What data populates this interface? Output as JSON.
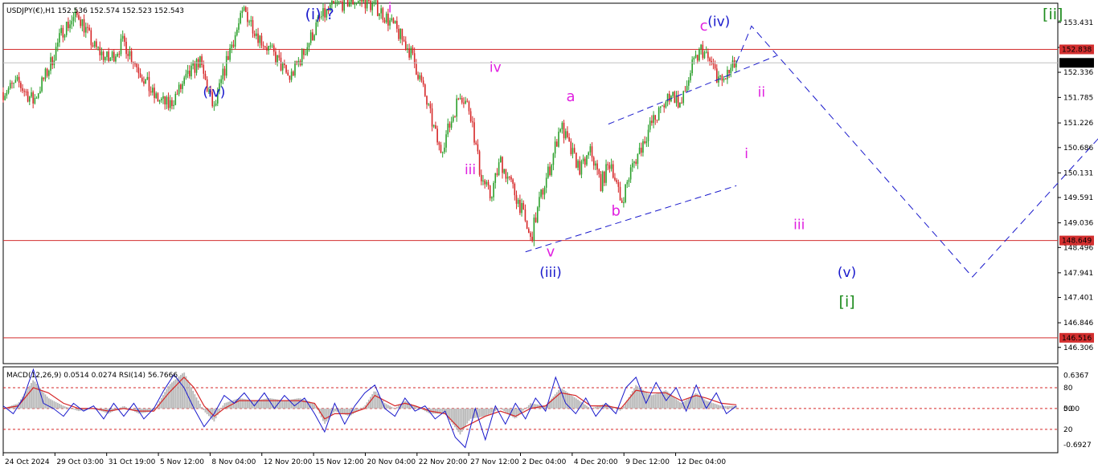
{
  "chart_data": {
    "type": "line",
    "title": "USDJPY(€),H1  152.536 152.574 152.523 152.543",
    "price_panel": {
      "ylim": [
        145.95,
        153.85
      ],
      "current_price": "152.543",
      "tick_labels": [
        "153.431",
        "152.881",
        "152.336",
        "151.785",
        "151.226",
        "150.686",
        "150.131",
        "149.591",
        "149.036",
        "148.496",
        "147.941",
        "147.401",
        "146.846",
        "146.306"
      ],
      "tick_values": [
        153.431,
        152.881,
        152.336,
        151.785,
        151.226,
        150.686,
        150.131,
        149.591,
        149.036,
        148.496,
        147.941,
        147.401,
        146.846,
        146.306
      ],
      "levels": [
        {
          "label": "152.838",
          "value": 152.838,
          "color": "#d32f2f"
        },
        {
          "label": "148.649",
          "value": 148.649,
          "color": "#d32f2f"
        },
        {
          "label": "146.516",
          "value": 146.516,
          "color": "#d32f2f"
        }
      ],
      "price_path": [
        [
          0,
          151.9
        ],
        [
          3,
          152.1
        ],
        [
          6,
          151.7
        ],
        [
          9,
          152.4
        ],
        [
          12,
          153.3
        ],
        [
          15,
          153.6
        ],
        [
          18,
          152.9
        ],
        [
          21,
          152.6
        ],
        [
          24,
          153.0
        ],
        [
          27,
          152.4
        ],
        [
          30,
          151.8
        ],
        [
          33,
          151.6
        ],
        [
          36,
          152.1
        ],
        [
          39,
          152.6
        ],
        [
          42,
          151.5
        ],
        [
          45,
          152.8
        ],
        [
          48,
          153.7
        ],
        [
          51,
          153.1
        ],
        [
          54,
          152.7
        ],
        [
          57,
          152.2
        ],
        [
          60,
          152.8
        ],
        [
          63,
          153.5
        ],
        [
          66,
          153.8
        ],
        [
          69,
          153.9
        ],
        [
          72,
          153.9
        ],
        [
          75,
          153.7
        ],
        [
          78,
          153.3
        ],
        [
          81,
          152.8
        ],
        [
          83,
          152.2
        ],
        [
          85,
          151.4
        ],
        [
          87,
          150.6
        ],
        [
          89,
          151.2
        ],
        [
          91,
          151.9
        ],
        [
          93,
          151.5
        ],
        [
          95,
          150.1
        ],
        [
          97,
          149.6
        ],
        [
          99,
          150.4
        ],
        [
          101,
          149.9
        ],
        [
          103,
          149.4
        ],
        [
          105,
          148.65
        ],
        [
          107,
          149.6
        ],
        [
          109,
          150.3
        ],
        [
          111,
          151.2
        ],
        [
          113,
          150.6
        ],
        [
          115,
          150.2
        ],
        [
          117,
          150.6
        ],
        [
          119,
          149.9
        ],
        [
          121,
          150.4
        ],
        [
          123,
          149.45
        ],
        [
          125,
          150.2
        ],
        [
          127,
          150.7
        ],
        [
          129,
          151.2
        ],
        [
          131,
          151.5
        ],
        [
          133,
          151.9
        ],
        [
          135,
          151.6
        ],
        [
          137,
          152.4
        ],
        [
          139,
          152.85
        ],
        [
          141,
          152.5
        ],
        [
          143,
          152.1
        ],
        [
          145,
          152.4
        ],
        [
          146,
          152.543
        ]
      ],
      "projection": [
        [
          146,
          152.543
        ],
        [
          149,
          153.35
        ],
        [
          193,
          147.85
        ],
        [
          243,
          153.9
        ]
      ],
      "channel_upper": [
        [
          120.5,
          151.2
        ],
        [
          154,
          152.7
        ]
      ],
      "channel_lower": [
        [
          104,
          148.4
        ],
        [
          146,
          149.85
        ]
      ],
      "wave_labels": [
        {
          "text": "(i) ?",
          "x": 63,
          "y": 153.5,
          "color": "#1a1acc",
          "size": 19
        },
        {
          "text": "i",
          "x": 77,
          "y": 153.65,
          "color": "#e020e0",
          "size": 17
        },
        {
          "text": "(iv)",
          "x": 42,
          "y": 151.8,
          "color": "#1a1acc",
          "size": 17
        },
        {
          "text": "iv",
          "x": 98,
          "y": 152.35,
          "color": "#e020e0",
          "size": 17
        },
        {
          "text": "iii",
          "x": 93,
          "y": 150.1,
          "color": "#e020e0",
          "size": 17
        },
        {
          "text": "a",
          "x": 113,
          "y": 151.7,
          "color": "#e020e0",
          "size": 18
        },
        {
          "text": "b",
          "x": 122,
          "y": 149.2,
          "color": "#e020e0",
          "size": 18
        },
        {
          "text": "v",
          "x": 109,
          "y": 148.3,
          "color": "#e020e0",
          "size": 18
        },
        {
          "text": "(iii)",
          "x": 109,
          "y": 147.85,
          "color": "#1a1acc",
          "size": 17
        },
        {
          "text": "c",
          "x": 139.5,
          "y": 153.25,
          "color": "#e020e0",
          "size": 18
        },
        {
          "text": "(iv)",
          "x": 142.5,
          "y": 153.35,
          "color": "#1a1acc",
          "size": 17
        },
        {
          "text": "ii",
          "x": 151,
          "y": 151.8,
          "color": "#e020e0",
          "size": 17
        },
        {
          "text": "i",
          "x": 148,
          "y": 150.45,
          "color": "#e020e0",
          "size": 17
        },
        {
          "text": "iii",
          "x": 158.5,
          "y": 148.9,
          "color": "#e020e0",
          "size": 17
        },
        {
          "text": "(v)",
          "x": 168,
          "y": 147.85,
          "color": "#1a1acc",
          "size": 17
        },
        {
          "text": "[i]",
          "x": 168,
          "y": 147.2,
          "color": "#1e8c1e",
          "size": 19
        },
        {
          "text": "[ii]",
          "x": 209,
          "y": 153.5,
          "color": "#1e8c1e",
          "size": 19
        }
      ]
    },
    "indicator_panel": {
      "label": "MACD(12,26,9) 0.0514 0.0274  RSI(14) 56.7666",
      "ylim": [
        -0.85,
        0.8
      ],
      "tick_labels": [
        "0.6367",
        "80",
        "50",
        "0.00",
        "20",
        "-0.6927"
      ],
      "tick_values": [
        0.6367,
        0.4,
        0.0,
        0.0,
        -0.4,
        -0.6927
      ],
      "levels": [
        0.4,
        0.0,
        -0.4
      ],
      "macd_path": [
        [
          0,
          0.0
        ],
        [
          3,
          0.1
        ],
        [
          6,
          0.55
        ],
        [
          9,
          0.2
        ],
        [
          12,
          0.05
        ],
        [
          15,
          -0.05
        ],
        [
          18,
          0.0
        ],
        [
          21,
          -0.1
        ],
        [
          24,
          0.05
        ],
        [
          27,
          -0.1
        ],
        [
          30,
          -0.05
        ],
        [
          33,
          0.45
        ],
        [
          36,
          0.7
        ],
        [
          38,
          0.3
        ],
        [
          40,
          -0.05
        ],
        [
          42,
          -0.25
        ],
        [
          44,
          0.1
        ],
        [
          47,
          0.2
        ],
        [
          50,
          0.15
        ],
        [
          53,
          0.2
        ],
        [
          56,
          0.15
        ],
        [
          59,
          0.2
        ],
        [
          62,
          0.1
        ],
        [
          64,
          -0.3
        ],
        [
          66,
          -0.05
        ],
        [
          69,
          -0.15
        ],
        [
          72,
          0.05
        ],
        [
          74,
          0.35
        ],
        [
          76,
          0.1
        ],
        [
          78,
          0.0
        ],
        [
          80,
          0.15
        ],
        [
          82,
          0.05
        ],
        [
          85,
          -0.1
        ],
        [
          88,
          -0.1
        ],
        [
          91,
          -0.5
        ],
        [
          93,
          -0.2
        ],
        [
          96,
          -0.15
        ],
        [
          99,
          0.0
        ],
        [
          102,
          -0.2
        ],
        [
          105,
          0.1
        ],
        [
          108,
          0.05
        ],
        [
          111,
          0.4
        ],
        [
          114,
          0.2
        ],
        [
          117,
          0.0
        ],
        [
          120,
          0.1
        ],
        [
          123,
          -0.05
        ],
        [
          126,
          0.45
        ],
        [
          129,
          0.25
        ],
        [
          132,
          0.35
        ],
        [
          135,
          0.1
        ],
        [
          138,
          0.3
        ],
        [
          140,
          0.15
        ],
        [
          143,
          0.05
        ],
        [
          146,
          0.05
        ]
      ],
      "signal_path": [
        [
          0,
          0.0
        ],
        [
          3,
          0.05
        ],
        [
          6,
          0.4
        ],
        [
          9,
          0.3
        ],
        [
          12,
          0.1
        ],
        [
          15,
          0.0
        ],
        [
          18,
          0.0
        ],
        [
          21,
          -0.05
        ],
        [
          24,
          0.0
        ],
        [
          27,
          -0.05
        ],
        [
          30,
          -0.05
        ],
        [
          33,
          0.3
        ],
        [
          36,
          0.6
        ],
        [
          38,
          0.4
        ],
        [
          40,
          0.05
        ],
        [
          42,
          -0.15
        ],
        [
          44,
          0.0
        ],
        [
          47,
          0.15
        ],
        [
          50,
          0.15
        ],
        [
          53,
          0.15
        ],
        [
          56,
          0.15
        ],
        [
          59,
          0.15
        ],
        [
          62,
          0.1
        ],
        [
          64,
          -0.2
        ],
        [
          66,
          -0.1
        ],
        [
          69,
          -0.1
        ],
        [
          72,
          0.0
        ],
        [
          74,
          0.25
        ],
        [
          76,
          0.15
        ],
        [
          78,
          0.05
        ],
        [
          80,
          0.1
        ],
        [
          82,
          0.05
        ],
        [
          85,
          -0.05
        ],
        [
          88,
          -0.1
        ],
        [
          91,
          -0.4
        ],
        [
          93,
          -0.3
        ],
        [
          96,
          -0.15
        ],
        [
          99,
          -0.05
        ],
        [
          102,
          -0.15
        ],
        [
          105,
          0.0
        ],
        [
          108,
          0.05
        ],
        [
          111,
          0.3
        ],
        [
          114,
          0.25
        ],
        [
          117,
          0.05
        ],
        [
          120,
          0.05
        ],
        [
          123,
          0.0
        ],
        [
          126,
          0.35
        ],
        [
          129,
          0.3
        ],
        [
          132,
          0.3
        ],
        [
          135,
          0.15
        ],
        [
          138,
          0.25
        ],
        [
          140,
          0.2
        ],
        [
          143,
          0.1
        ],
        [
          146,
          0.07
        ]
      ],
      "rsi_path": [
        [
          0,
          0.05
        ],
        [
          2,
          -0.1
        ],
        [
          4,
          0.2
        ],
        [
          6,
          0.75
        ],
        [
          8,
          0.1
        ],
        [
          10,
          0.0
        ],
        [
          12,
          -0.15
        ],
        [
          14,
          0.1
        ],
        [
          16,
          -0.05
        ],
        [
          18,
          0.05
        ],
        [
          20,
          -0.2
        ],
        [
          22,
          0.1
        ],
        [
          24,
          -0.15
        ],
        [
          26,
          0.1
        ],
        [
          28,
          -0.2
        ],
        [
          30,
          0.0
        ],
        [
          32,
          0.35
        ],
        [
          34,
          0.65
        ],
        [
          36,
          0.4
        ],
        [
          38,
          0.0
        ],
        [
          40,
          -0.35
        ],
        [
          42,
          -0.1
        ],
        [
          44,
          0.25
        ],
        [
          46,
          0.1
        ],
        [
          48,
          0.3
        ],
        [
          50,
          0.05
        ],
        [
          52,
          0.3
        ],
        [
          54,
          0.0
        ],
        [
          56,
          0.25
        ],
        [
          58,
          0.05
        ],
        [
          60,
          0.2
        ],
        [
          62,
          -0.1
        ],
        [
          64,
          -0.45
        ],
        [
          66,
          0.1
        ],
        [
          68,
          -0.3
        ],
        [
          70,
          0.05
        ],
        [
          72,
          0.3
        ],
        [
          74,
          0.45
        ],
        [
          76,
          0.0
        ],
        [
          78,
          -0.15
        ],
        [
          80,
          0.2
        ],
        [
          82,
          -0.05
        ],
        [
          84,
          0.05
        ],
        [
          86,
          -0.2
        ],
        [
          88,
          -0.05
        ],
        [
          90,
          -0.55
        ],
        [
          92,
          -0.75
        ],
        [
          94,
          0.0
        ],
        [
          96,
          -0.6
        ],
        [
          98,
          0.05
        ],
        [
          100,
          -0.3
        ],
        [
          102,
          0.1
        ],
        [
          104,
          -0.2
        ],
        [
          106,
          0.2
        ],
        [
          108,
          -0.05
        ],
        [
          110,
          0.6
        ],
        [
          112,
          0.1
        ],
        [
          114,
          -0.1
        ],
        [
          116,
          0.2
        ],
        [
          118,
          -0.15
        ],
        [
          120,
          0.1
        ],
        [
          122,
          -0.1
        ],
        [
          124,
          0.4
        ],
        [
          126,
          0.6
        ],
        [
          128,
          0.1
        ],
        [
          130,
          0.5
        ],
        [
          132,
          0.15
        ],
        [
          134,
          0.4
        ],
        [
          136,
          -0.05
        ],
        [
          138,
          0.45
        ],
        [
          140,
          0.0
        ],
        [
          142,
          0.3
        ],
        [
          144,
          -0.1
        ],
        [
          146,
          0.05
        ]
      ]
    },
    "x_labels": [
      "24 Oct 2024",
      "29 Oct 03:00",
      "31 Oct 19:00",
      "5 Nov 12:00",
      "8 Nov 04:00",
      "12 Nov 20:00",
      "15 Nov 12:00",
      "20 Nov 04:00",
      "22 Nov 20:00",
      "27 Nov 12:00",
      "2 Dec 04:00",
      "4 Dec 20:00",
      "9 Dec 12:00",
      "12 Dec 04:00"
    ],
    "x_label_positions": [
      0,
      10.3,
      20.6,
      30.9,
      41.2,
      51.5,
      61.8,
      72.1,
      82.4,
      92.7,
      103,
      113.3,
      123.6,
      133.9
    ],
    "x_range": [
      0,
      210
    ],
    "colors": {
      "bull": "#2ca02c",
      "bear": "#d62728",
      "level": "#d32f2f",
      "projection": "#1a1acc",
      "channel": "#1a1acc",
      "macd_hist": "#b8b8b8",
      "signal": "#d62728",
      "rsi": "#1a1acc"
    }
  }
}
